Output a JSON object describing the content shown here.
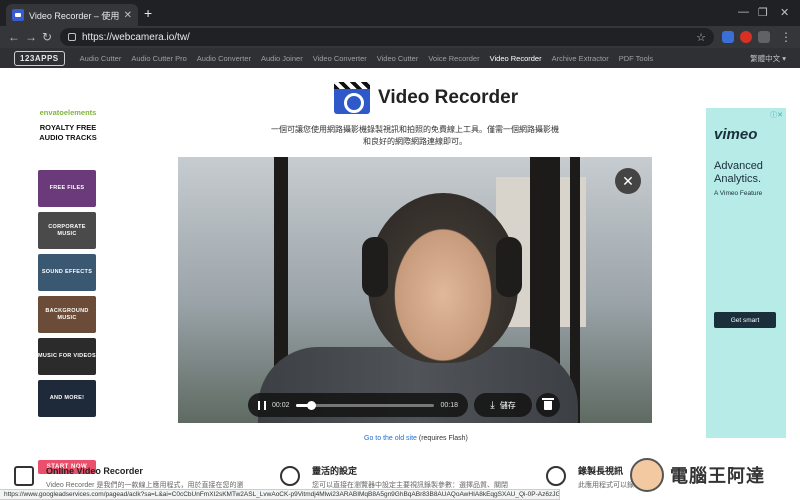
{
  "browser": {
    "tab_title": "Video Recorder – 使用網路",
    "tab_close": "✕",
    "new_tab": "+",
    "url": "https://webcamera.io/tw/",
    "status_url": "https://www.googleadservices.com/pagead/aclk?sa=L&ai=C0cCbUnFmXI2sKMTw2ASL_LvwAoCK-p9Vitmdj4Mlwi23ARABIMqB8A5gn9GhBqABr83B8AUAQoAwHIA8kEqgSXAU_Qi-0P-Az6zJGMQzEs..."
  },
  "site": {
    "logo": "123APPS",
    "nav": [
      "Audio Cutter",
      "Audio Cutter Pro",
      "Audio Converter",
      "Audio Joiner",
      "Video Converter",
      "Video Cutter",
      "Voice Recorder",
      "Video Recorder",
      "Archive Extractor",
      "PDF Tools"
    ],
    "active_nav_index": 7,
    "language": "繁體中文 ▾"
  },
  "main": {
    "title": "Video Recorder",
    "description": "一個可讓您使用網路攝影機錄製視訊和拍照的免費線上工具。僅需一個網路攝影機和良好的網際網路連線即可。",
    "player": {
      "current_time": "00:02",
      "duration": "00:18",
      "progress": 0.11,
      "save_label": "儲存"
    },
    "old_site_link": "Go to the old site",
    "old_site_note": "(requires Flash)"
  },
  "left_ad": {
    "brand_prefix": "envato",
    "brand_suffix": "elements",
    "headline": "ROYALTY FREE AUDIO TRACKS",
    "tiles": [
      {
        "label": "FREE FILES",
        "color": "#6b3a7a"
      },
      {
        "label": "CORPORATE MUSIC",
        "color": "#4a4a4a"
      },
      {
        "label": "SOUND EFFECTS",
        "color": "#3b5873"
      },
      {
        "label": "BACKGROUND MUSIC",
        "color": "#6b4c38"
      },
      {
        "label": "MUSIC FOR VIDEOS",
        "color": "#2b2b2b"
      },
      {
        "label": "AND MORE!",
        "color": "#1e2a3a"
      }
    ],
    "cta": "START NOW"
  },
  "right_ad": {
    "brand": "vimeo",
    "headline": "Advanced Analytics.",
    "sub": "A Vimeo Feature",
    "cta": "Get smart"
  },
  "features": [
    {
      "title": "Online Video Recorder",
      "text": "Video Recorder 是我們的一款線上應用程式，用於直接在您的瀏"
    },
    {
      "title": "靈活的設定",
      "text": "您可以直接在瀏覽器中設定主要視訊錄製參數：選擇品質、關閉"
    },
    {
      "title": "錄製長視訊",
      "text": "此應用程式可以錄製長達一小時的視訊"
    }
  ],
  "watermark": "電腦王阿達",
  "colors": {
    "tabbar": "#202124",
    "toolbar": "#35363a",
    "accent_link": "#1e6fd0",
    "vimeo_bg": "#b6ebe7",
    "start_now": "#ea4f6c"
  }
}
